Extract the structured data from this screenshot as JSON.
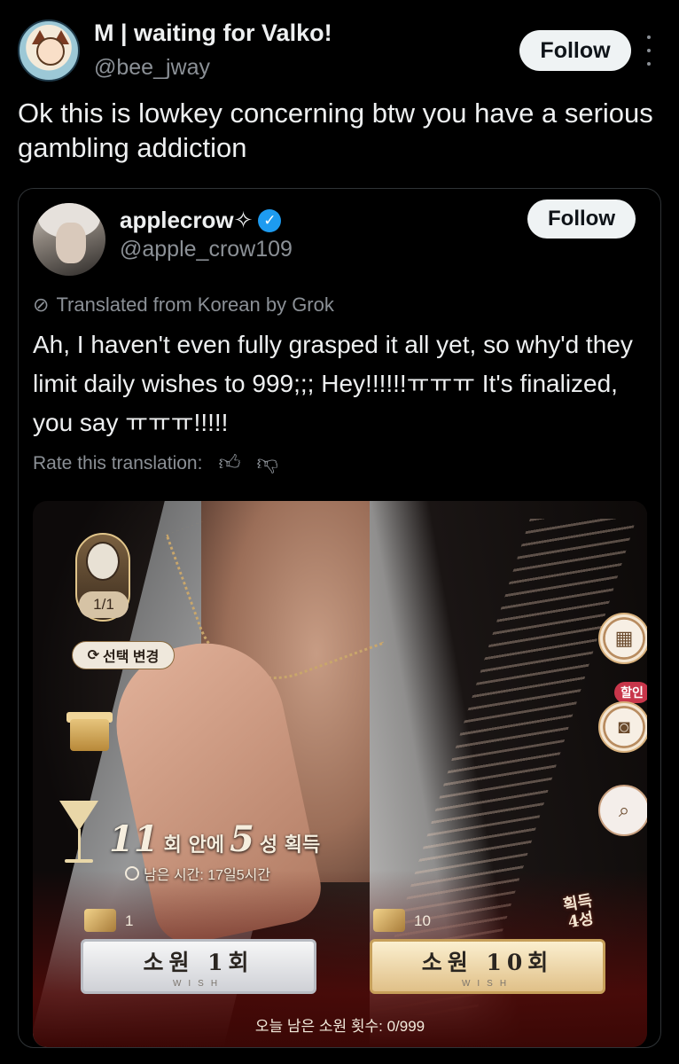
{
  "post": {
    "author_name": "M | waiting for Valko!",
    "author_handle": "@bee_jway",
    "follow_label": "Follow",
    "text": "Ok this is lowkey concerning btw you have a serious gambling addiction"
  },
  "quote": {
    "author_name": "applecrow✧",
    "author_handle": "@apple_crow109",
    "follow_label": "Follow",
    "translated_note": "Translated from Korean by Grok",
    "text": "Ah, I haven't even fully grasped it all yet, so why'd they limit daily wishes to 999;;; Hey!!!!!!ㅠㅠㅠ It's finalized, you say ㅠㅠㅠ!!!!!",
    "rate_label": "Rate this translation:"
  },
  "game": {
    "slot_count": "1/1",
    "change_selection": "선택 변경",
    "discount_tag": "할인",
    "banner_num1": "11",
    "banner_text1": "회 안에",
    "banner_num2": "5",
    "banner_text2": "성 획득",
    "remaining_time": "남은 시간: 17일5시간",
    "ticket_count_1": "1",
    "ticket_count_10": "10",
    "wish_1_label": "소원 1회",
    "wish_10_label": "소원 10회",
    "wish_sub": "WISH",
    "four_star_line1": "획득",
    "four_star_line2": "4성",
    "daily_remaining": "오늘 남은 소원 횟수: 0/999"
  }
}
